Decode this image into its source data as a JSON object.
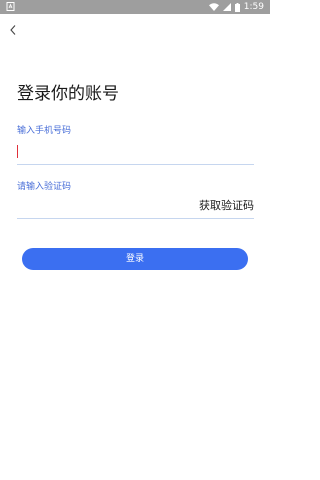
{
  "status_bar": {
    "time": "1:59",
    "icons": [
      "sim-icon",
      "wifi-icon",
      "signal-icon",
      "battery-icon"
    ],
    "background": "#9e9e9e"
  },
  "header": {
    "back_icon": "chevron-left-icon"
  },
  "page": {
    "title": "登录你的账号"
  },
  "phone": {
    "label": "输入手机号码",
    "value": "",
    "placeholder": ""
  },
  "code": {
    "label": "请输入验证码",
    "value": "",
    "placeholder": "",
    "get_code_label": "获取验证码"
  },
  "login": {
    "label": "登录",
    "color": "#3b6ff1"
  },
  "colors": {
    "label": "#4a6fd8",
    "underline": "#c6d6ef",
    "caret": "#e0303a"
  }
}
